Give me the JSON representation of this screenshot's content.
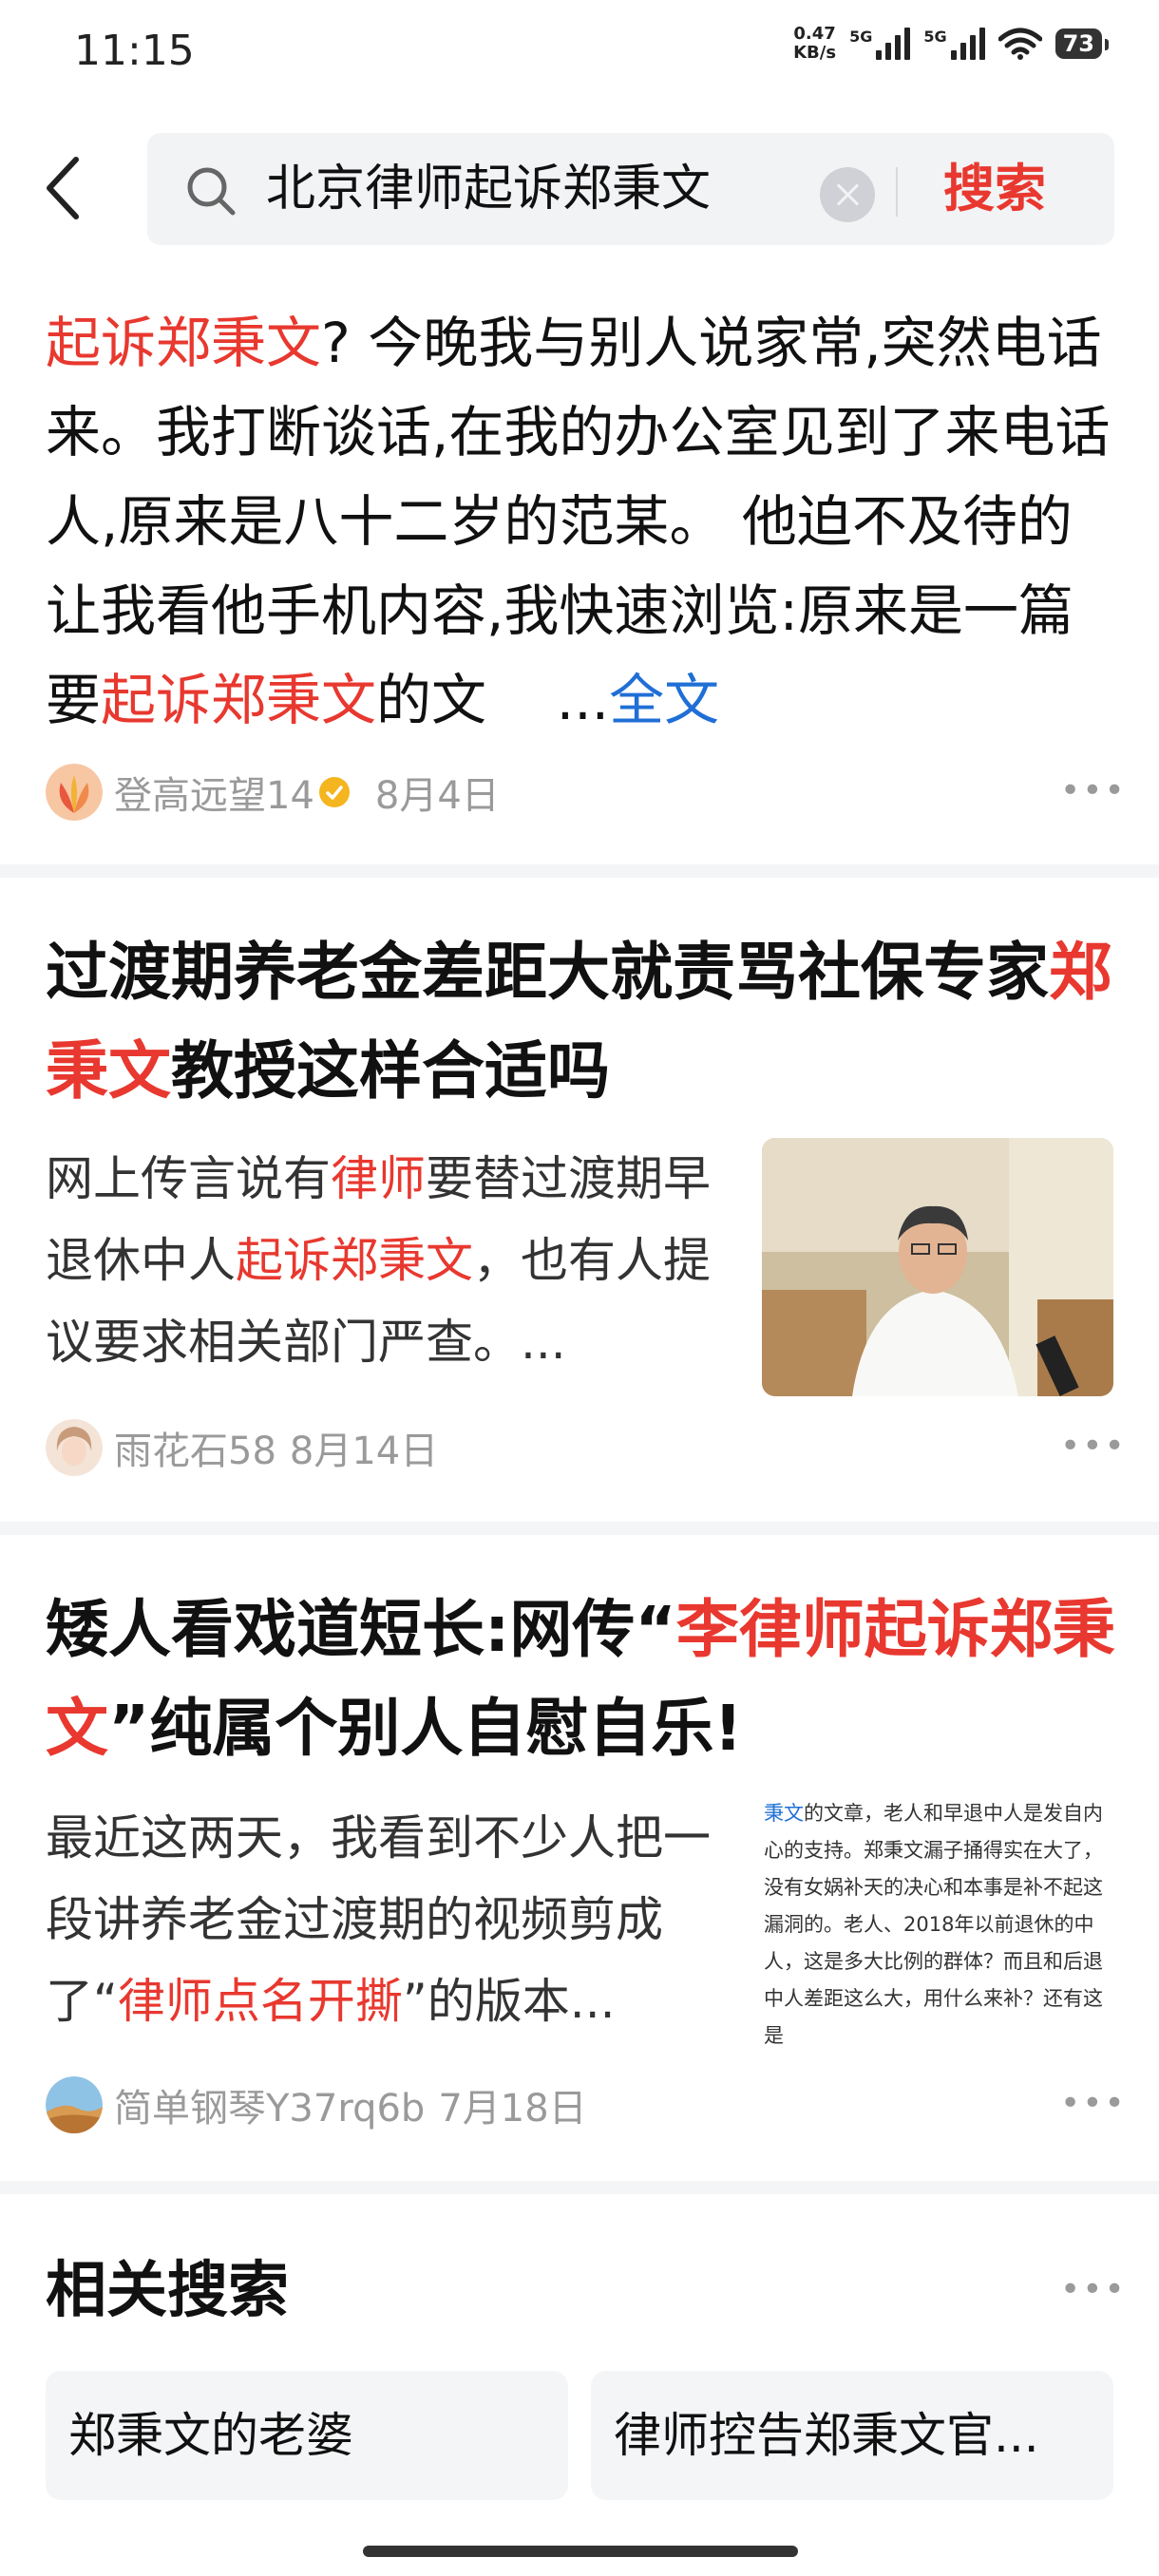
{
  "status_bar": {
    "time": "11:15",
    "net_speed_value": "0.47",
    "net_speed_unit": "KB/s",
    "sim1": "5G",
    "sim2": "5G",
    "battery": "73"
  },
  "search": {
    "query": "北京律师起诉郑秉文",
    "button_label": "搜索",
    "icons": [
      "back-arrow-icon",
      "search-icon",
      "clear-icon"
    ]
  },
  "results": [
    {
      "text_parts": {
        "p1_hl": "起诉郑秉文",
        "p1": "? 今晚我与别人说家常,突然电话来。我打断谈话,在我的办公室见到了来电话人,原来是八十二岁的范某。 他迫不及待的让我看他手机内容,我快速浏览:原来是一篇要",
        "p2_hl": "起诉郑秉文",
        "p2": "的文",
        "ellipsis": "...",
        "more": "全文"
      },
      "author": "登高远望14",
      "date": "8月4日",
      "verified_badge_color": "#f5b51f"
    },
    {
      "title_line1": "过渡期养老金差距大就责骂社保专家",
      "title_hl": "郑秉文",
      "title_rest": "教授这样合适吗",
      "snippet": {
        "a": "网上传言说有",
        "b_hl": "律师",
        "c": "要替过渡期早退休中人",
        "d_hl": "起诉郑秉文",
        "e": "，也有人提议要求相关部门严查。..."
      },
      "author": "雨花石58",
      "date": "8月14日"
    },
    {
      "title_a": "矮人看戏道短长:网传“",
      "title_hl": "李律师起诉郑秉文",
      "title_b": "”纯属个别人自慰自乐!",
      "snippet": {
        "a": "最近这两天，我看到不少人把一段讲养老金过渡期的视频剪成了“",
        "b_hl": "律师点名开撕",
        "c": "”的版本..."
      },
      "thumb_text_hl": "秉文",
      "thumb_text": "的文章，老人和早退中人是发自内心的支持。郑秉文漏子捅得实在大了，没有女娲补天的决心和本事是补不起这漏洞的。老人、2018年以前退休的中人，这是多大比例的群体？而且和后退中人差距这么大，用什么来补？还有这是",
      "author": "简单钢琴Y37rq6b",
      "date": "7月18日"
    }
  ],
  "related": {
    "title": "相关搜索",
    "items": [
      "郑秉文的老婆",
      "律师控告郑秉文官..."
    ]
  },
  "colors": {
    "highlight": "#e8382f",
    "link": "#1f6fd6",
    "meta": "#9a9a9a"
  }
}
